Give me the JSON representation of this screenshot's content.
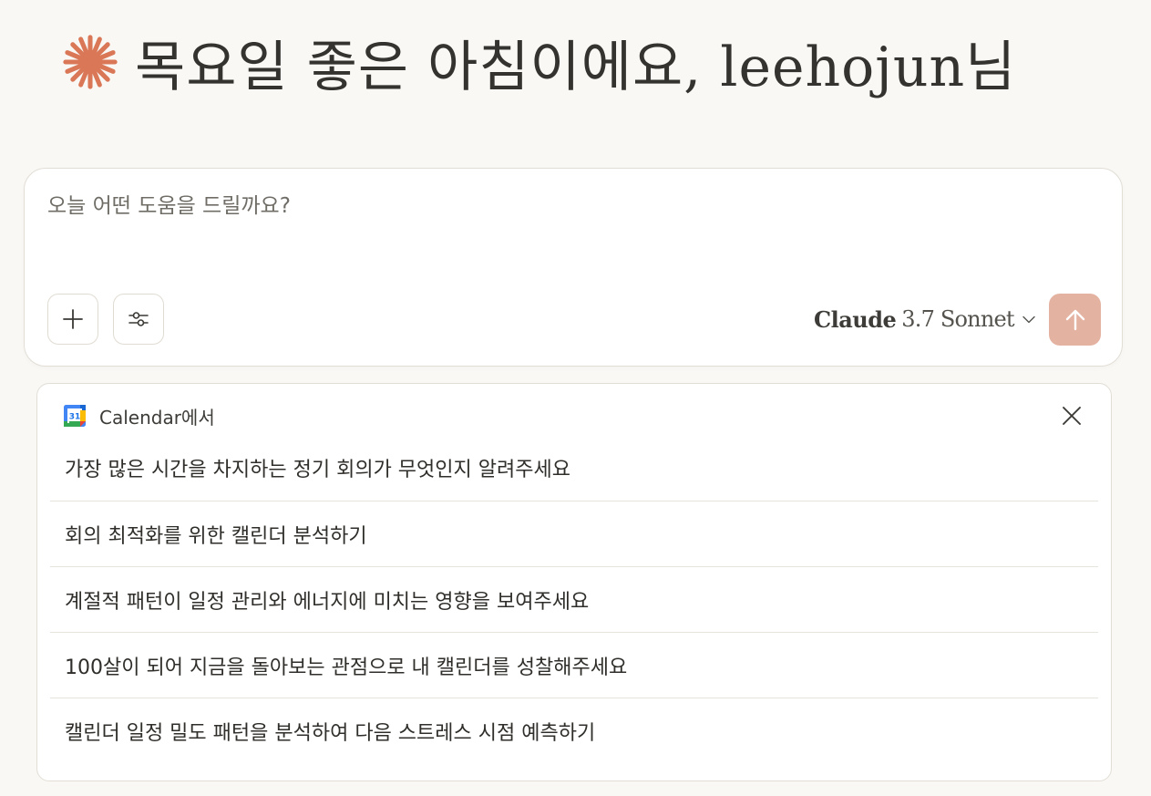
{
  "greeting": {
    "text": "목요일 좋은 아침이에요, leehojun님",
    "icon": "sparkle-icon",
    "icon_color": "#d97757"
  },
  "composer": {
    "placeholder": "오늘 어떤 도움을 드릴까요?",
    "add_icon": "plus-icon",
    "options_icon": "sliders-icon",
    "model": {
      "name": "Claude",
      "version": "3.7 Sonnet"
    },
    "send_icon": "arrow-up-icon",
    "send_color": "#e4b2a0"
  },
  "suggestions": {
    "source_label": "Calendar에서",
    "source_icon": "google-calendar-icon",
    "calendar_icon_text": "31",
    "close_icon": "close-icon",
    "items": [
      "가장 많은 시간을 차지하는 정기 회의가 무엇인지 알려주세요",
      "회의 최적화를 위한 캘린더 분석하기",
      "계절적 패턴이 일정 관리와 에너지에 미치는 영향을 보여주세요",
      "100살이 되어 지금을 돌아보는 관점으로 내 캘린더를 성찰해주세요",
      "캘린더 일정 밀도 패턴을 분석하여 다음 스트레스 시점 예측하기"
    ]
  }
}
